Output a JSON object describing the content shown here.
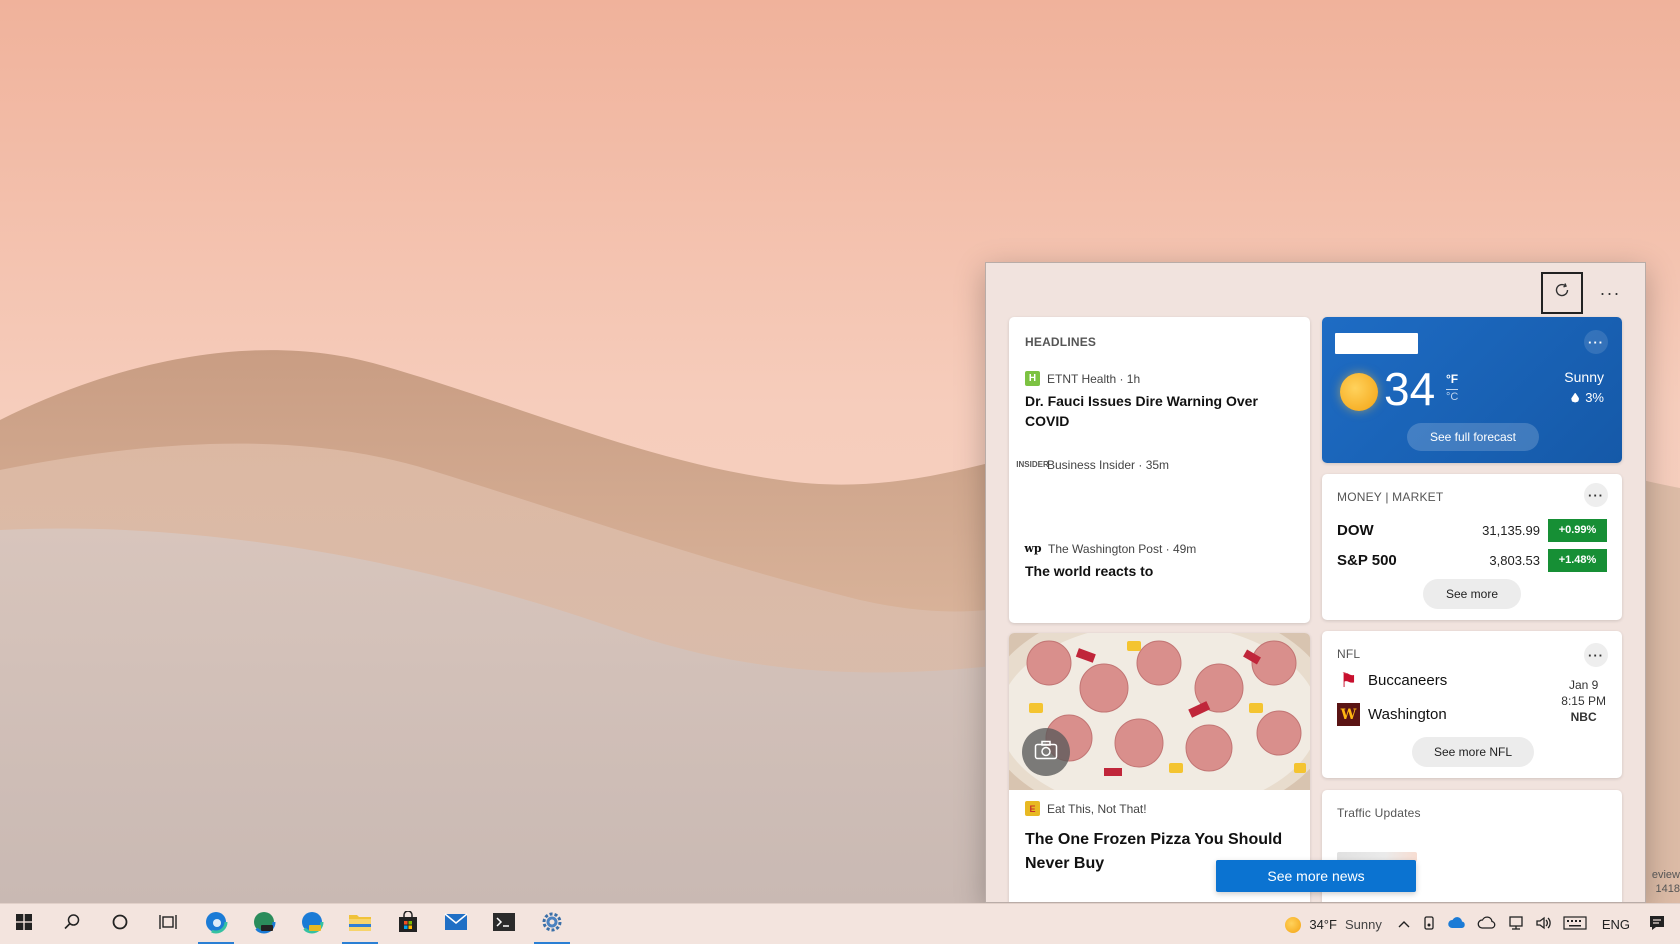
{
  "panel": {
    "refresh_icon": "refresh-icon",
    "more_label": "···",
    "see_more_news": "See more news"
  },
  "headlines": {
    "label": "HEADLINES",
    "items": [
      {
        "source": "ETNT Health · 1h",
        "logo": "H",
        "title": "Dr. Fauci Issues Dire Warning Over COVID"
      },
      {
        "source": "Business Insider · 35m",
        "logo": "INSIDER",
        "title": ""
      },
      {
        "source": "The Washington Post · 49m",
        "logo": "wp",
        "title": "The world reacts to"
      }
    ]
  },
  "feature_story": {
    "source": "Eat This, Not That!",
    "logo": "E",
    "title": "The One Frozen Pizza You Should Never Buy",
    "image_icon": "camera-icon"
  },
  "weather": {
    "temperature": "34",
    "unit_f": "°F",
    "unit_c": "°C",
    "condition": "Sunny",
    "precipitation": "3%",
    "forecast_button": "See full forecast",
    "more_label": "···"
  },
  "market": {
    "label": "MONEY | MARKET",
    "more_label": "···",
    "rows": [
      {
        "name": "DOW",
        "value": "31,135.99",
        "change": "+0.99%"
      },
      {
        "name": "S&P 500",
        "value": "3,803.53",
        "change": "+1.48%"
      }
    ],
    "see_more": "See more",
    "change_color": "#168f35"
  },
  "nfl": {
    "label": "NFL",
    "more_label": "···",
    "teams": [
      {
        "name": "Buccaneers",
        "logo": "⚑"
      },
      {
        "name": "Washington",
        "logo": "W"
      }
    ],
    "date": "Jan 9",
    "time": "8:15 PM",
    "network": "NBC",
    "see_more": "See more NFL"
  },
  "traffic": {
    "label": "Traffic Updates"
  },
  "watermark": {
    "line1": "eview",
    "line2": "1418"
  },
  "taskbar": {
    "weather_temp": "34°F",
    "weather_condition": "Sunny",
    "language": "ENG",
    "accent": "#2a7fd4"
  }
}
